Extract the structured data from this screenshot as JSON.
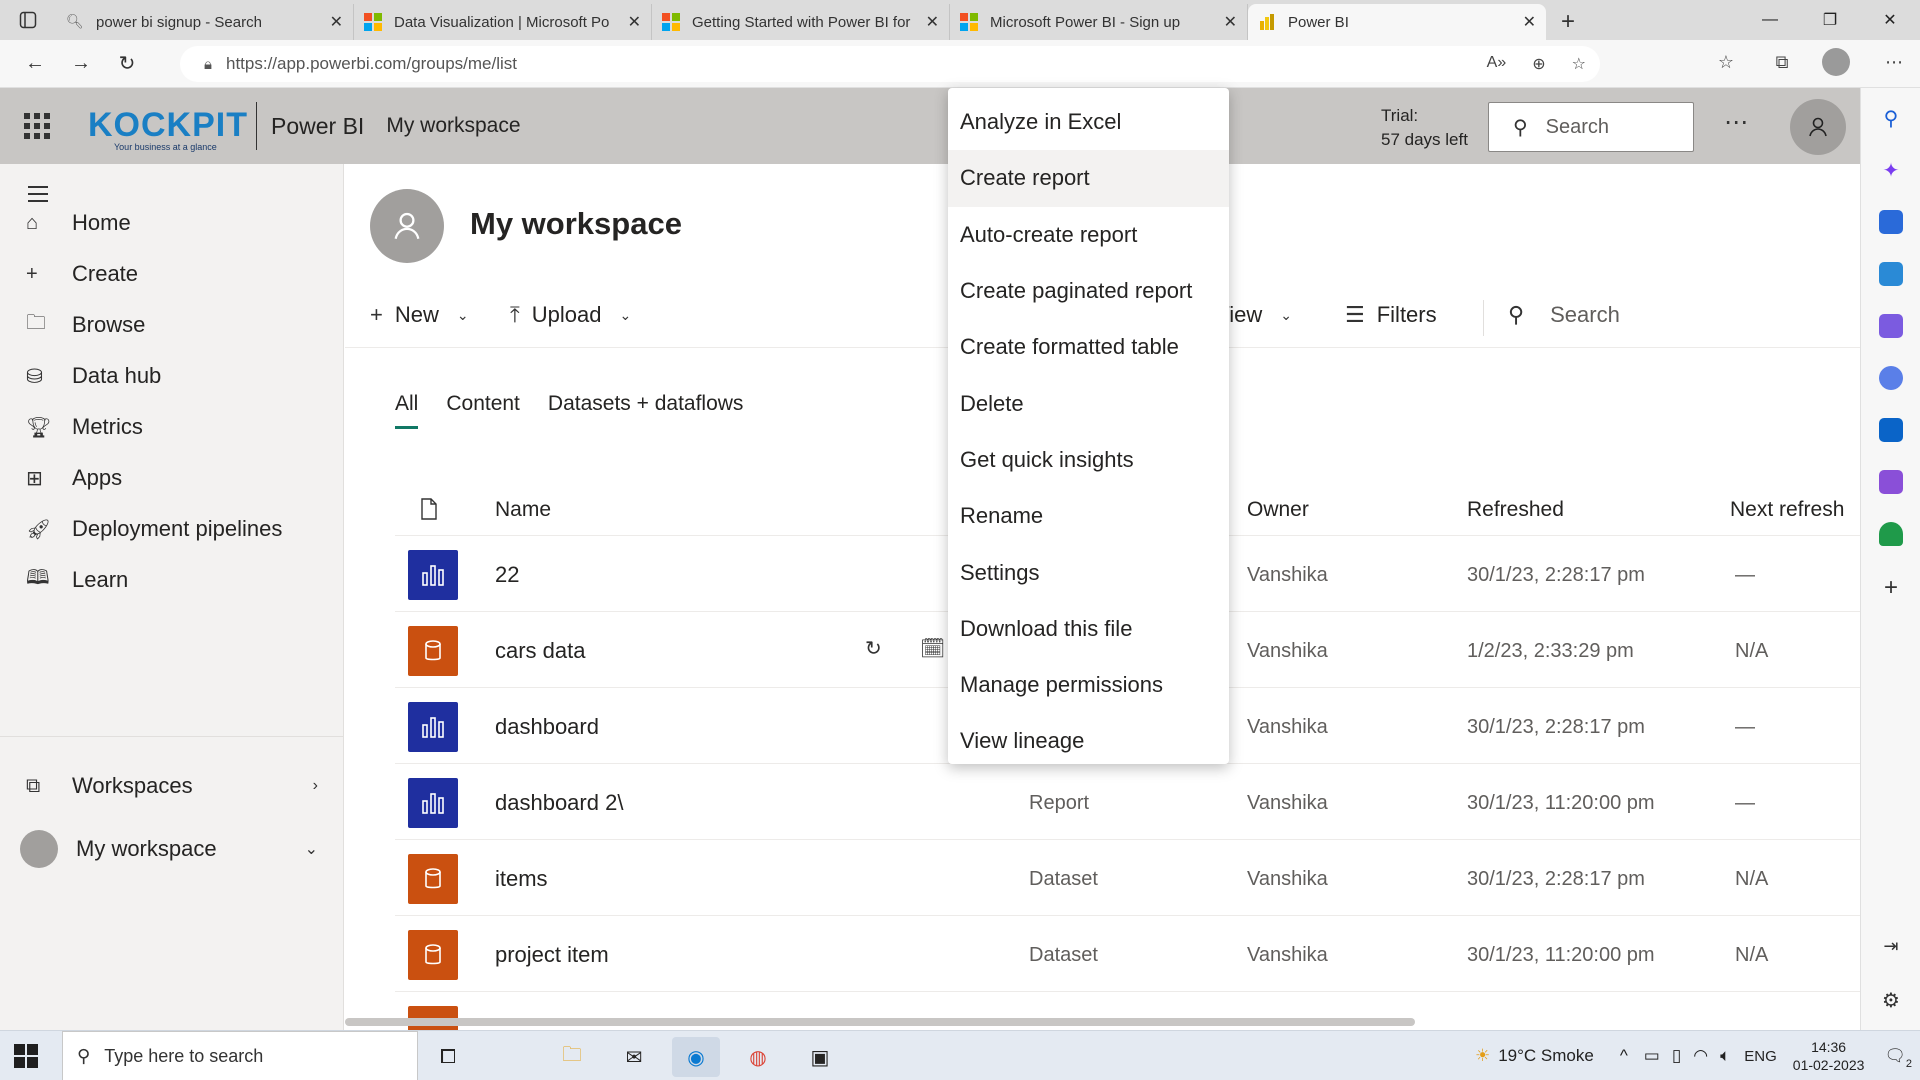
{
  "browser": {
    "tabs": [
      {
        "title": "power bi signup - Search",
        "active": false
      },
      {
        "title": "Data Visualization | Microsoft Po",
        "active": false
      },
      {
        "title": "Getting Started with Power BI for",
        "active": false
      },
      {
        "title": "Microsoft Power BI - Sign up",
        "active": false
      },
      {
        "title": "Power BI",
        "active": true
      }
    ],
    "url": "https://app.powerbi.com/groups/me/list"
  },
  "header": {
    "logo_text": "KOCKPIT",
    "logo_tagline": "Your business at a glance",
    "app_name": "Power BI",
    "workspace": "My workspace",
    "trial_line1": "Trial:",
    "trial_line2": "57 days left",
    "search_placeholder": "Search"
  },
  "nav": {
    "items": [
      {
        "label": "Home",
        "icon": "home-icon"
      },
      {
        "label": "Create",
        "icon": "plus-icon"
      },
      {
        "label": "Browse",
        "icon": "folder-icon"
      },
      {
        "label": "Data hub",
        "icon": "database-icon"
      },
      {
        "label": "Metrics",
        "icon": "trophy-icon"
      },
      {
        "label": "Apps",
        "icon": "apps-icon"
      },
      {
        "label": "Deployment pipelines",
        "icon": "rocket-icon"
      },
      {
        "label": "Learn",
        "icon": "book-icon"
      }
    ],
    "workspaces": "Workspaces",
    "my_workspace": "My workspace"
  },
  "main": {
    "title": "My workspace",
    "commands": {
      "new": "New",
      "upload": "Upload",
      "view": "View",
      "filters": "Filters",
      "search": "Search"
    },
    "tabs": [
      "All",
      "Content",
      "Datasets + dataflows"
    ],
    "columns": {
      "name": "Name",
      "owner": "Owner",
      "refreshed": "Refreshed",
      "next_refresh": "Next refresh"
    },
    "rows": [
      {
        "name": "22",
        "type": "",
        "owner": "Vanshika",
        "refreshed": "30/1/23, 2:28:17 pm",
        "next": "—",
        "kind": "report"
      },
      {
        "name": "cars data",
        "type": "",
        "owner": "Vanshika",
        "refreshed": "1/2/23, 2:33:29 pm",
        "next": "N/A",
        "kind": "dataset"
      },
      {
        "name": "dashboard",
        "type": "",
        "owner": "Vanshika",
        "refreshed": "30/1/23, 2:28:17 pm",
        "next": "—",
        "kind": "report"
      },
      {
        "name": "dashboard 2\\",
        "type": "Report",
        "owner": "Vanshika",
        "refreshed": "30/1/23, 11:20:00 pm",
        "next": "—",
        "kind": "report"
      },
      {
        "name": "items",
        "type": "Dataset",
        "owner": "Vanshika",
        "refreshed": "30/1/23, 2:28:17 pm",
        "next": "N/A",
        "kind": "dataset"
      },
      {
        "name": "project item",
        "type": "Dataset",
        "owner": "Vanshika",
        "refreshed": "30/1/23, 11:20:00 pm",
        "next": "N/A",
        "kind": "dataset"
      }
    ]
  },
  "context_menu": {
    "items": [
      "Analyze in Excel",
      "Create report",
      "Auto-create report",
      "Create paginated report",
      "Create formatted table",
      "Delete",
      "Get quick insights",
      "Rename",
      "Settings",
      "Download this file",
      "Manage permissions",
      "View lineage"
    ]
  },
  "taskbar": {
    "search_placeholder": "Type here to search",
    "weather": "19°C  Smoke",
    "lang": "ENG",
    "time": "14:36",
    "date": "01-02-2023",
    "notif_count": "2"
  },
  "colors": {
    "report_tile": "#1f2f9f",
    "dataset_tile": "#ca5010",
    "header_bg": "#c8c6c4",
    "accent": "#117865"
  }
}
